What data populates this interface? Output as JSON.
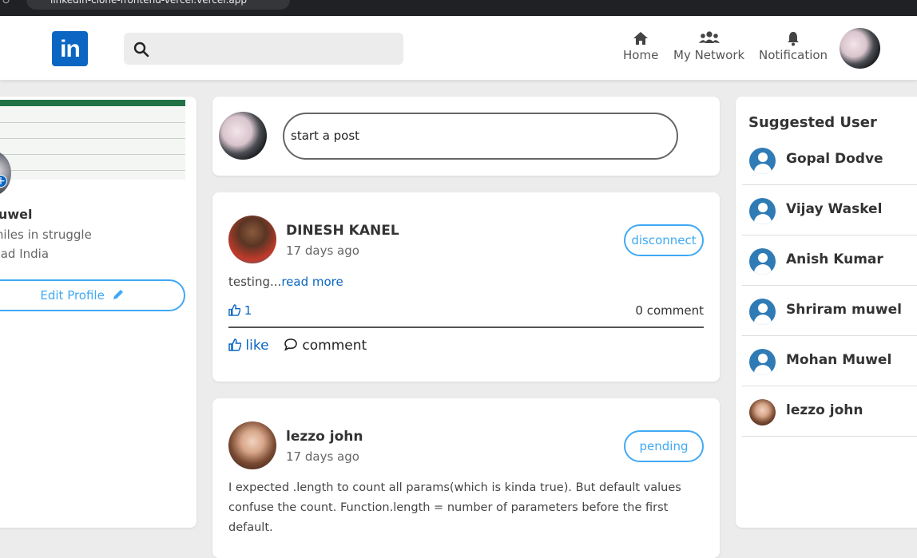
{
  "browser": {
    "url": "linkedin-clone-frontend-vercel.vercel.app"
  },
  "navbar": {
    "logo_text": "in",
    "search_placeholder": "",
    "items": [
      {
        "label": "Home",
        "icon": "home-icon"
      },
      {
        "label": "My Network",
        "icon": "network-icon"
      },
      {
        "label": "Notification",
        "icon": "bell-icon"
      }
    ]
  },
  "profile": {
    "name": "Muwel",
    "tagline": "smiles in struggle",
    "location": "abad India",
    "edit_label": "Edit Profile"
  },
  "composer": {
    "placeholder": "start a post"
  },
  "posts": [
    {
      "author": "DINESH KANEL",
      "time": "17 days ago",
      "status": "disconnect",
      "text": "testing...",
      "read_more": "read more",
      "likes": "1",
      "comments": "0 comment",
      "like_label": "like",
      "comment_label": "comment"
    },
    {
      "author": "lezzo john",
      "time": "17 days ago",
      "status": "pending",
      "body": "I expected .length to count all params(which is kinda true). But default values confuse the count. Function.length = number of parameters before the first default."
    }
  ],
  "suggested": {
    "title": "Suggested User",
    "users": [
      "Gopal Dodve",
      "Vijay Waskel",
      "Anish Kumar",
      "Shriram muwel",
      "Mohan Muwel",
      "lezzo john"
    ]
  },
  "colors": {
    "brand": "#0a66c2",
    "accent": "#3fa9f5",
    "background": "#ececec"
  }
}
